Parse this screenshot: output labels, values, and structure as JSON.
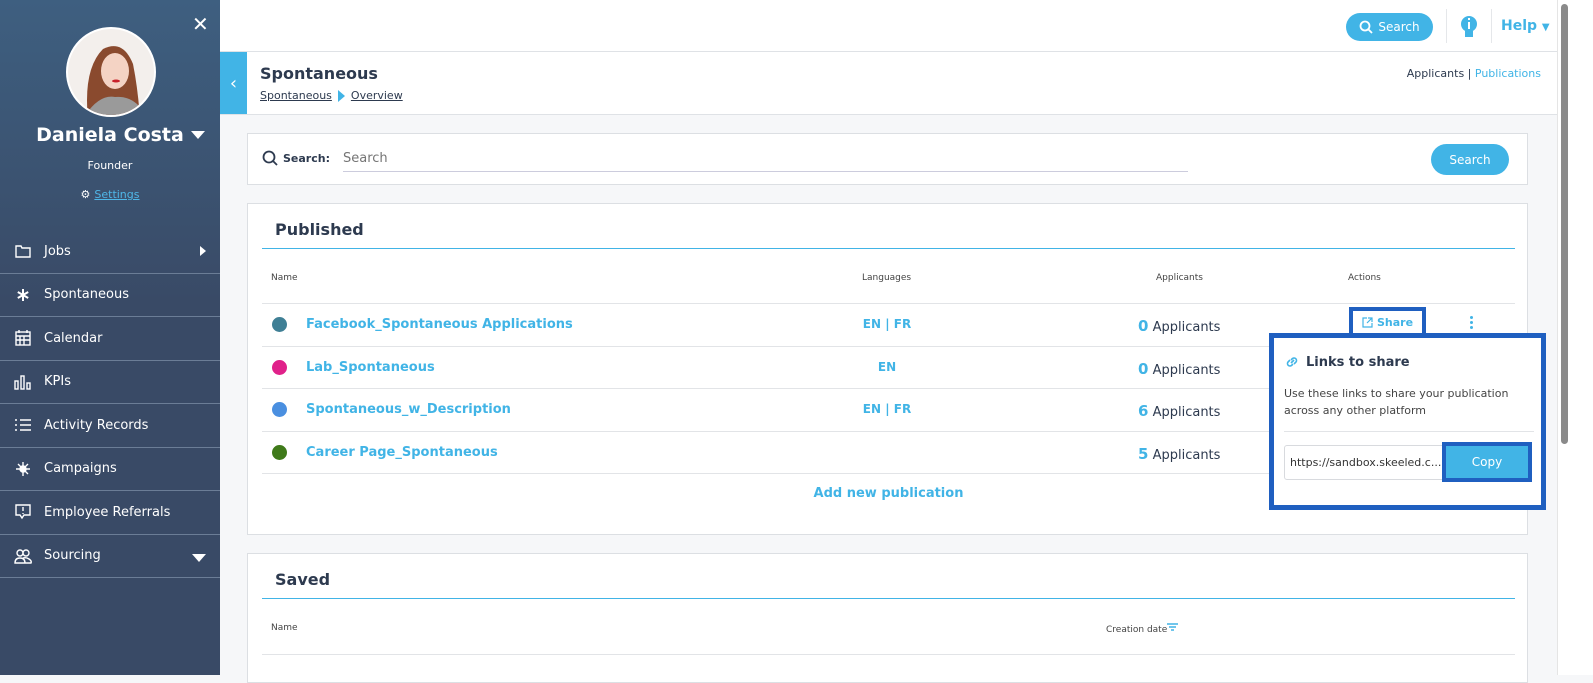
{
  "sidebar": {
    "user_name": "Daniela Costa",
    "role": "Founder",
    "settings_label": "Settings",
    "items": [
      {
        "label": "Jobs",
        "icon": "folder-icon"
      },
      {
        "label": "Spontaneous",
        "icon": "asterisk-icon"
      },
      {
        "label": "Calendar",
        "icon": "calendar-icon"
      },
      {
        "label": "KPIs",
        "icon": "bar-chart-icon"
      },
      {
        "label": "Activity Records",
        "icon": "list-icon"
      },
      {
        "label": "Campaigns",
        "icon": "network-icon"
      },
      {
        "label": "Employee Referrals",
        "icon": "alert-message-icon"
      },
      {
        "label": "Sourcing",
        "icon": "users-icon"
      }
    ]
  },
  "topbar": {
    "search_label": "Search",
    "help_label": "Help"
  },
  "header": {
    "title": "Spontaneous",
    "breadcrumb": [
      "Spontaneous",
      "Overview"
    ],
    "links": {
      "applicants": "Applicants",
      "separator": "|",
      "publications": "Publications"
    }
  },
  "search": {
    "label": "Search:",
    "placeholder": "Search",
    "button": "Search"
  },
  "published": {
    "title": "Published",
    "columns": [
      "Name",
      "Languages",
      "Applicants",
      "Actions"
    ],
    "rows": [
      {
        "name": "Facebook_Spontaneous Applications",
        "color": "#3f7f95",
        "languages": "EN | FR",
        "count": "0",
        "unit": "Applicants"
      },
      {
        "name": "Lab_Spontaneous",
        "color": "#e0218a",
        "languages": "EN",
        "count": "0",
        "unit": "Applicants"
      },
      {
        "name": "Spontaneous_w_Description",
        "color": "#4a8fe0",
        "languages": "EN | FR",
        "count": "6",
        "unit": "Applicants"
      },
      {
        "name": "Career Page_Spontaneous",
        "color": "#3f7a1a",
        "languages": "",
        "count": "5",
        "unit": "Applicants"
      }
    ],
    "add_label": "Add new publication",
    "share_label": "Share"
  },
  "popup": {
    "title": "Links to share",
    "description": "Use these links to share your publication across any other platform",
    "url": "https://sandbox.skeeled.c...",
    "copy_label": "Copy"
  },
  "saved": {
    "title": "Saved",
    "columns": [
      "Name",
      "Creation date"
    ]
  },
  "colors": {
    "accent": "#41b4e6",
    "highlight": "#1f5fc0",
    "sidebar": "#3a4b67"
  }
}
